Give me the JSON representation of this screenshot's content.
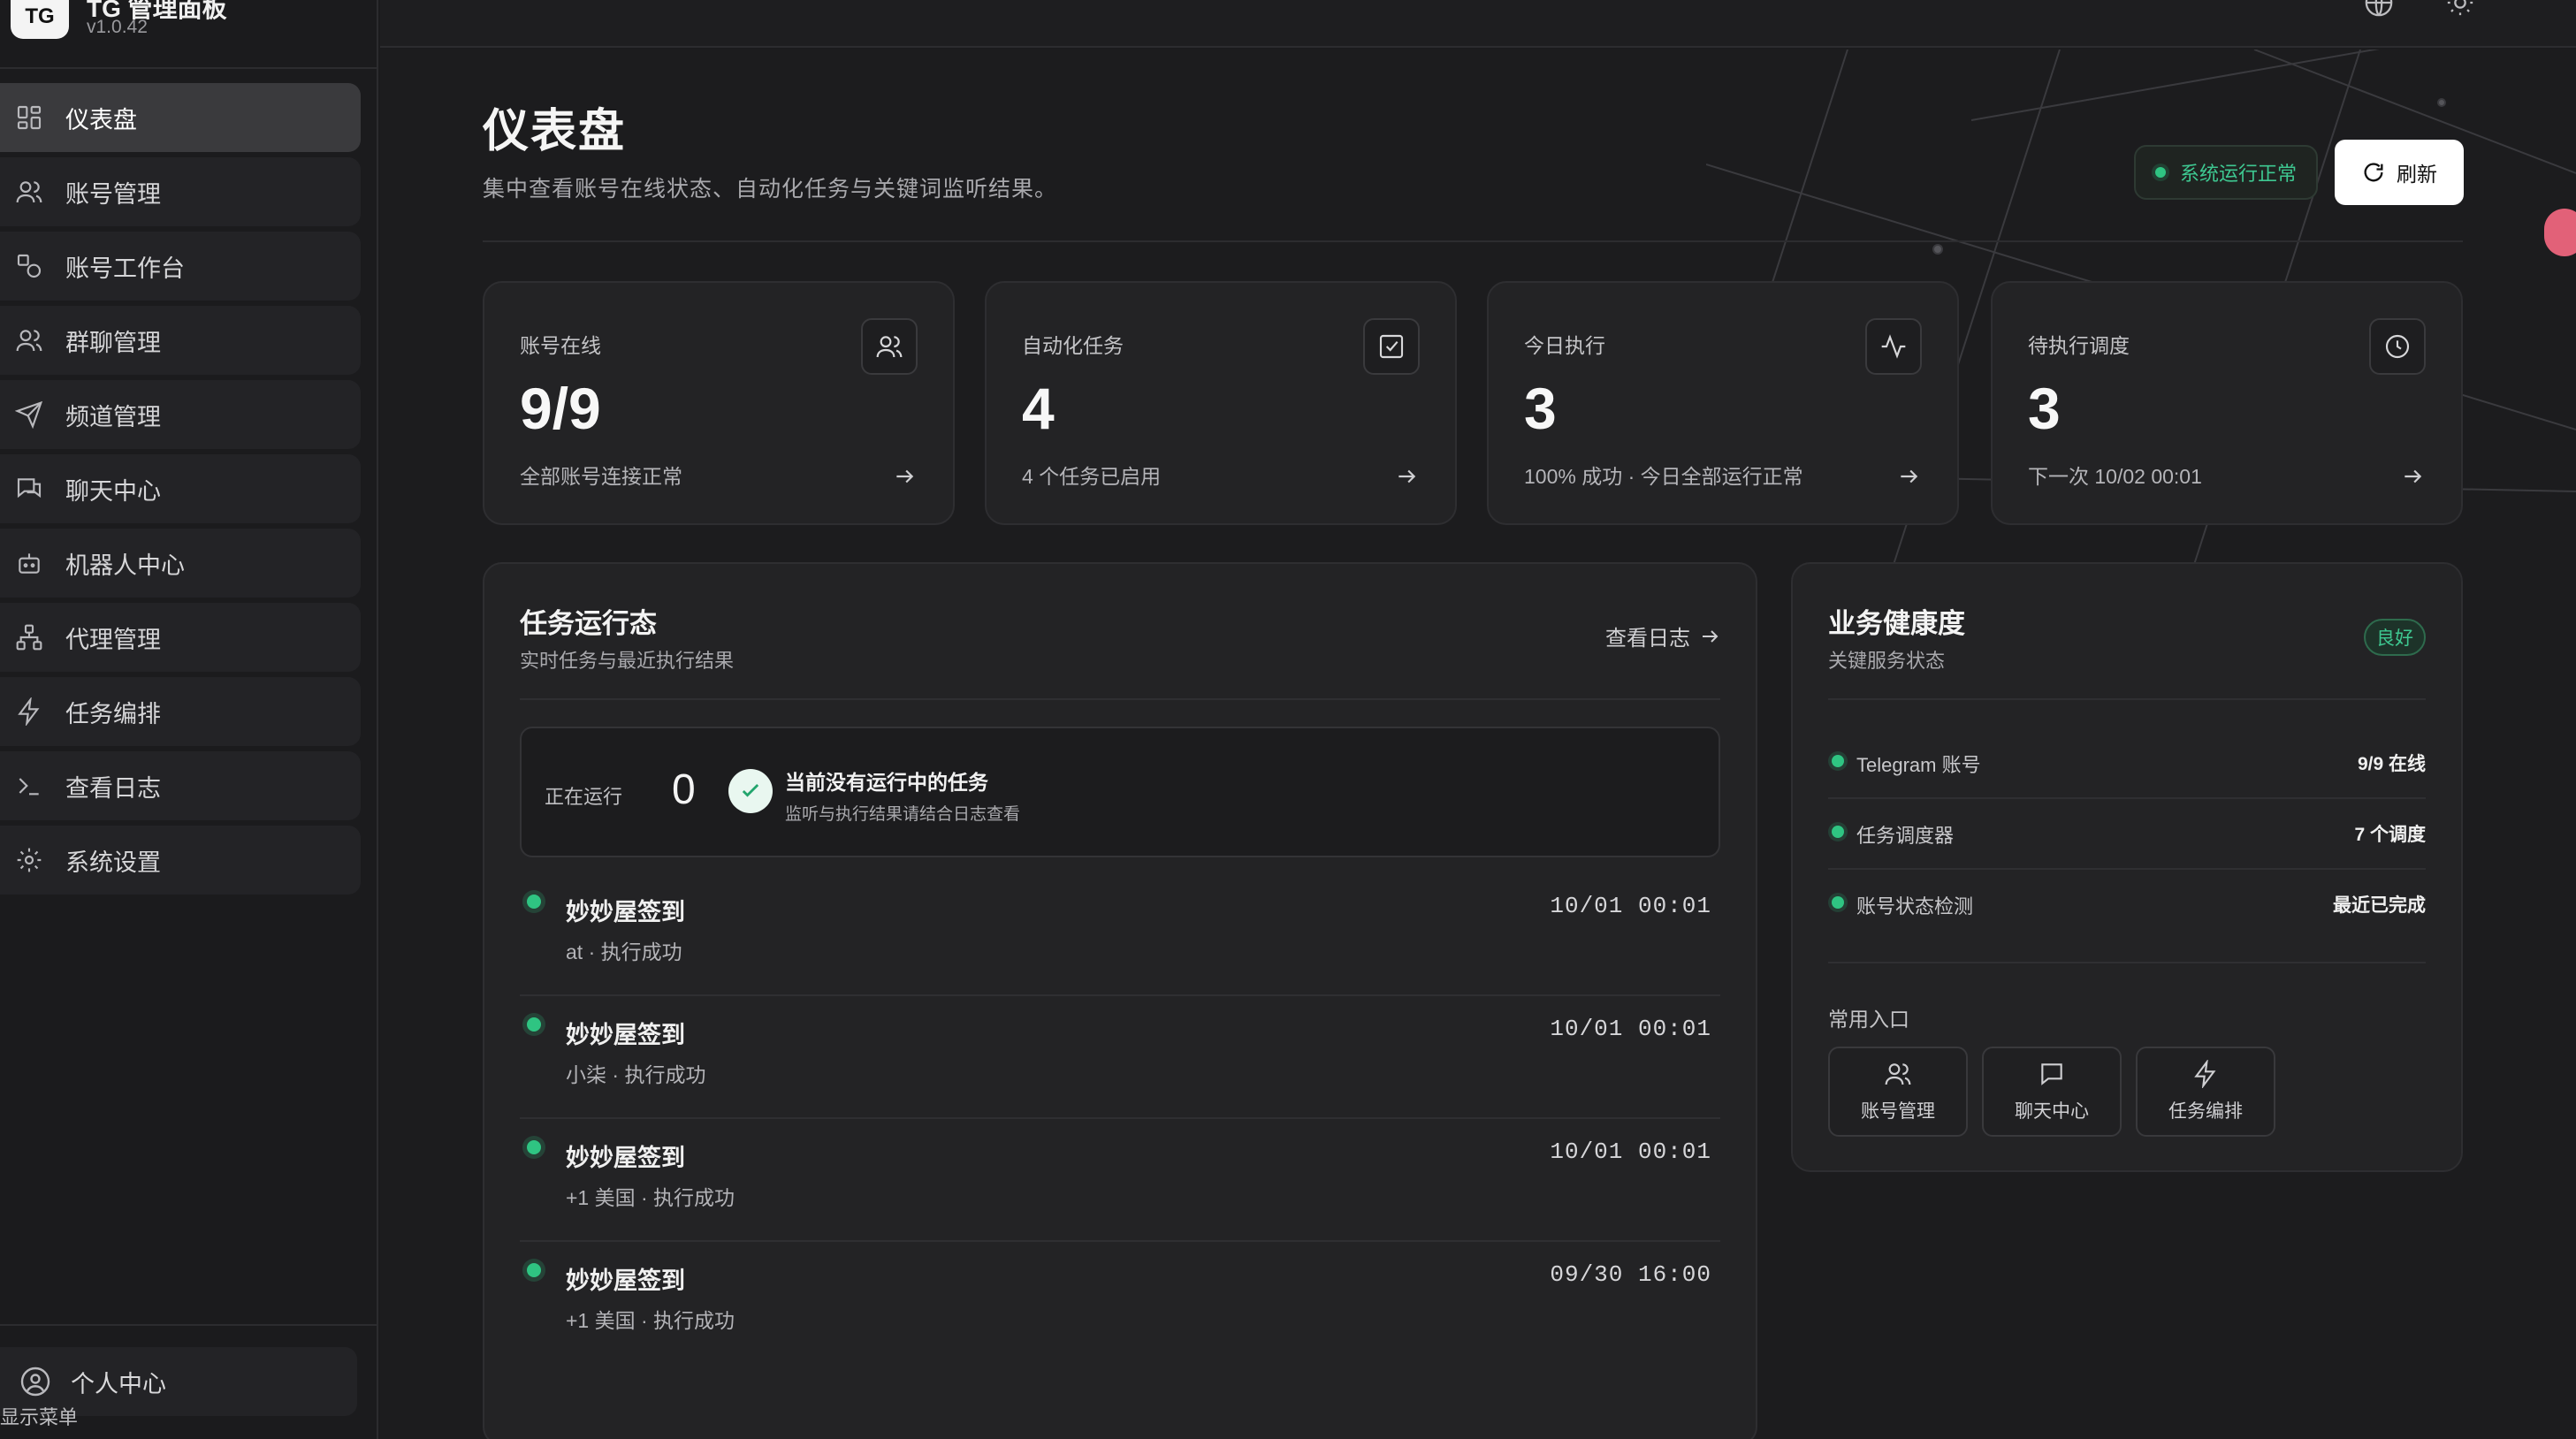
{
  "brand": {
    "logo": "TG",
    "name": "TG 管理面板",
    "version": "v1.0.42"
  },
  "nav": [
    {
      "label": "仪表盘",
      "icon": "dashboard-icon",
      "active": true
    },
    {
      "label": "账号管理",
      "icon": "users-icon"
    },
    {
      "label": "账号工作台",
      "icon": "workbench-icon"
    },
    {
      "label": "群聊管理",
      "icon": "group-icon"
    },
    {
      "label": "频道管理",
      "icon": "send-icon"
    },
    {
      "label": "聊天中心",
      "icon": "chat-icon"
    },
    {
      "label": "机器人中心",
      "icon": "bot-icon"
    },
    {
      "label": "代理管理",
      "icon": "network-icon"
    },
    {
      "label": "任务编排",
      "icon": "lightning-icon"
    },
    {
      "label": "查看日志",
      "icon": "terminal-icon"
    },
    {
      "label": "系统设置",
      "icon": "gear-icon"
    }
  ],
  "profile": {
    "label": "个人中心"
  },
  "show_menu": "显示菜单",
  "header": {
    "title": "仪表盘",
    "subtitle": "集中查看账号在线状态、自动化任务与关键词监听结果。",
    "status": "系统运行正常",
    "refresh": "刷新"
  },
  "stats": [
    {
      "label": "账号在线",
      "value": "9/9",
      "desc": "全部账号连接正常",
      "icon": "users-icon"
    },
    {
      "label": "自动化任务",
      "value": "4",
      "desc": "4 个任务已启用",
      "icon": "checkbox-icon"
    },
    {
      "label": "今日执行",
      "value": "3",
      "desc": "100% 成功 · 今日全部运行正常",
      "icon": "activity-icon"
    },
    {
      "label": "待执行调度",
      "value": "3",
      "desc": "下一次 10/02 00:01",
      "icon": "clock-icon"
    }
  ],
  "tasks": {
    "title": "任务运行态",
    "subtitle": "实时任务与最近执行结果",
    "view_log": "查看日志",
    "running_label": "正在运行",
    "running_count": "0",
    "running_title": "当前没有运行中的任务",
    "running_sub": "监听与执行结果请结合日志查看",
    "items": [
      {
        "name": "妙妙屋签到",
        "meta": "at · 执行成功",
        "time": "10/01 00:01"
      },
      {
        "name": "妙妙屋签到",
        "meta": "小柒 · 执行成功",
        "time": "10/01 00:01"
      },
      {
        "name": "妙妙屋签到",
        "meta": "+1 美国 · 执行成功",
        "time": "10/01 00:01"
      },
      {
        "name": "妙妙屋签到",
        "meta": "+1 美国 · 执行成功",
        "time": "09/30 16:00"
      }
    ]
  },
  "health": {
    "title": "业务健康度",
    "subtitle": "关键服务状态",
    "badge": "良好",
    "rows": [
      {
        "name": "Telegram 账号",
        "value": "9/9 在线"
      },
      {
        "name": "任务调度器",
        "value": "7 个调度"
      },
      {
        "name": "账号状态检测",
        "value": "最近已完成"
      }
    ],
    "quick_title": "常用入口",
    "quick": [
      {
        "label": "账号管理",
        "icon": "users-icon"
      },
      {
        "label": "聊天中心",
        "icon": "chat-icon"
      },
      {
        "label": "任务编排",
        "icon": "lightning-icon"
      }
    ]
  },
  "colors": {
    "accent": "#2fc482",
    "background": "#1c1c1e",
    "card": "#232325"
  }
}
